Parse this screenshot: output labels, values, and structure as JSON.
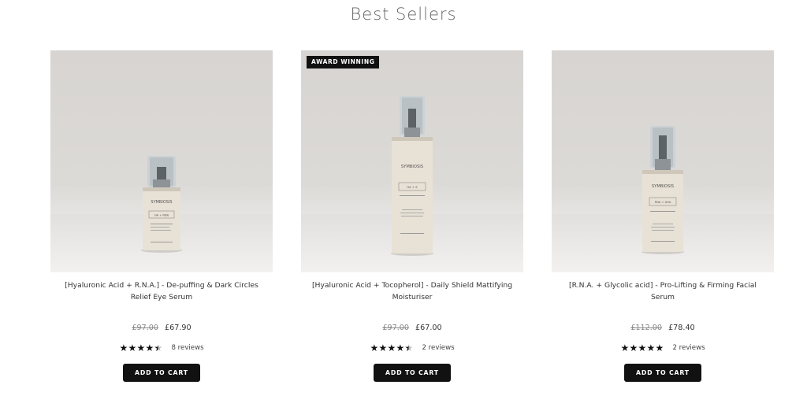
{
  "section": {
    "title": "Best Sellers"
  },
  "products": [
    {
      "name": "[Hyaluronic Acid + R.N.A.] - De-puffing & Dark Circles Relief Eye Serum",
      "badge": "",
      "old_price": "£97.00",
      "price": "£67.90",
      "rating": 4.5,
      "reviews": "8 reviews",
      "cta": "ADD TO CART",
      "bottle_brand": "SYMBIOSIS",
      "bottle_formula": "HA + RNA"
    },
    {
      "name": "[Hyaluronic Acid + Tocopherol] - Daily Shield Mattifying Moisturiser",
      "badge": "AWARD WINNING",
      "old_price": "£97.00",
      "price": "£67.00",
      "rating": 4.5,
      "reviews": "2 reviews",
      "cta": "ADD TO CART",
      "bottle_brand": "SYMBIOSIS",
      "bottle_formula": "HA + E"
    },
    {
      "name": "[R.N.A. + Glycolic acid] - Pro-Lifting & Firming Facial Serum",
      "badge": "",
      "old_price": "£112.00",
      "price": "£78.40",
      "rating": 5,
      "reviews": "2 reviews",
      "cta": "ADD TO CART",
      "bottle_brand": "SYMBIOSIS",
      "bottle_formula": "RNA + AHA"
    }
  ]
}
